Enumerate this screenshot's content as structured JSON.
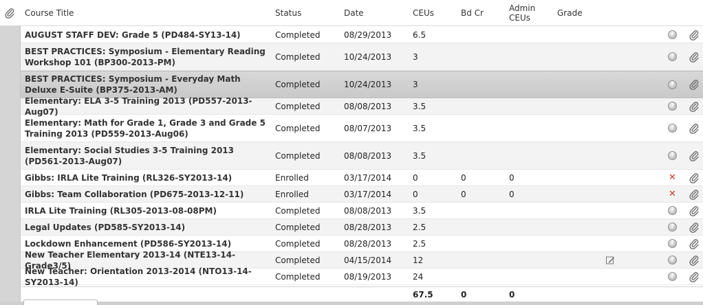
{
  "header": {
    "course_title": "Course Title",
    "status": "Status",
    "date": "Date",
    "ceus": "CEUs",
    "bd_cr": "Bd Cr",
    "admin_ceus_1": "Admin",
    "admin_ceus_2": "CEUs",
    "grade": "Grade"
  },
  "rows": [
    {
      "title": "AUGUST STAFF DEV: Grade 5 (PD484-SY13-14)",
      "status": "Completed",
      "date": "08/29/2013",
      "ceus": "6.5",
      "bd_cr": "",
      "admin_ceus": "",
      "action": "help"
    },
    {
      "title": "BEST PRACTICES: Symposium - Elementary Reading Workshop 101 (BP300-2013-PM)",
      "status": "Completed",
      "date": "10/24/2013",
      "ceus": "3",
      "bd_cr": "",
      "admin_ceus": "",
      "action": "help"
    },
    {
      "title": "BEST PRACTICES: Symposium - Everyday Math Deluxe E-Suite (BP375-2013-AM)",
      "status": "Completed",
      "date": "10/24/2013",
      "ceus": "3",
      "bd_cr": "",
      "admin_ceus": "",
      "action": "help"
    },
    {
      "title": "Elementary: ELA 3-5 Training 2013 (PD557-2013-Aug07)",
      "status": "Completed",
      "date": "08/08/2013",
      "ceus": "3.5",
      "bd_cr": "",
      "admin_ceus": "",
      "action": "help"
    },
    {
      "title": "Elementary: Math for Grade 1, Grade 3 and Grade 5 Training 2013 (PD559-2013-Aug06)",
      "status": "Completed",
      "date": "08/07/2013",
      "ceus": "3.5",
      "bd_cr": "",
      "admin_ceus": "",
      "action": "help"
    },
    {
      "title": "Elementary: Social Studies 3-5 Training 2013 (PD561-2013-Aug07)",
      "status": "Completed",
      "date": "08/08/2013",
      "ceus": "3.5",
      "bd_cr": "",
      "admin_ceus": "",
      "action": "help"
    },
    {
      "title": "Gibbs: IRLA Lite Training (RL326-SY2013-14)",
      "status": "Enrolled",
      "date": "03/17/2014",
      "ceus": "0",
      "bd_cr": "0",
      "admin_ceus": "0",
      "action": "remove"
    },
    {
      "title": "Gibbs: Team Collaboration (PD675-2013-12-11)",
      "status": "Enrolled",
      "date": "03/17/2014",
      "ceus": "0",
      "bd_cr": "0",
      "admin_ceus": "0",
      "action": "remove"
    },
    {
      "title": "IRLA Lite Training (RL305-2013-08-08PM)",
      "status": "Completed",
      "date": "08/08/2013",
      "ceus": "3.5",
      "bd_cr": "",
      "admin_ceus": "",
      "action": "help"
    },
    {
      "title": "Legal Updates (PD585-SY2013-14)",
      "status": "Completed",
      "date": "08/28/2013",
      "ceus": "2.5",
      "bd_cr": "",
      "admin_ceus": "",
      "action": "help"
    },
    {
      "title": "Lockdown Enhancement (PD586-SY2013-14)",
      "status": "Completed",
      "date": "08/28/2013",
      "ceus": "2.5",
      "bd_cr": "",
      "admin_ceus": "",
      "action": "help"
    },
    {
      "title": "New Teacher Elementary 2013-14 (NTE13-14-Grade3/5)",
      "status": "Completed",
      "date": "04/15/2014",
      "ceus": "12",
      "bd_cr": "",
      "admin_ceus": "",
      "action": "help",
      "edit": true
    },
    {
      "title": "New Teacher: Orientation 2013-2014 (NTO13-14-SY2013-14)",
      "status": "Completed",
      "date": "08/19/2013",
      "ceus": "24",
      "bd_cr": "",
      "admin_ceus": "",
      "action": "help"
    }
  ],
  "totals": {
    "ceus": "67.5",
    "bd_cr": "0",
    "admin_ceus": "0"
  },
  "icons": {
    "help": "?",
    "remove": "✕"
  }
}
